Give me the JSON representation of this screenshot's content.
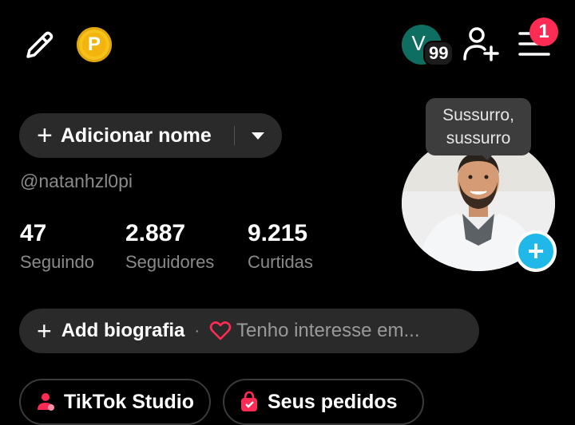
{
  "header": {
    "coin_letter": "P",
    "avatar_letter": "V",
    "avatar_count": "99",
    "notification_count": "1"
  },
  "profile": {
    "name_button_plus": "+",
    "name_button_label": "Adicionar nome",
    "username": "@natanhzl0pi",
    "tooltip_line1": "Sussurro,",
    "tooltip_line2": "sussurro",
    "add_photo_plus": "+"
  },
  "stats": [
    {
      "value": "47",
      "label": "Seguindo"
    },
    {
      "value": "2.887",
      "label": "Seguidores"
    },
    {
      "value": "9.215",
      "label": "Curtidas"
    }
  ],
  "bio": {
    "plus": "+",
    "add_label": "Add biografia",
    "separator": "·",
    "interest_text": "Tenho interesse em..."
  },
  "buttons": {
    "studio_label": "TikTok Studio",
    "orders_label": "Seus pedidos"
  },
  "colors": {
    "background": "#000000",
    "pill": "#2a2a2a",
    "badge_red": "#fe2c55",
    "accent_blue": "#20b8e8",
    "coin_gold": "#f7c21b",
    "avatar_teal": "#0f6e62",
    "heart_pink": "#fe2c55"
  }
}
